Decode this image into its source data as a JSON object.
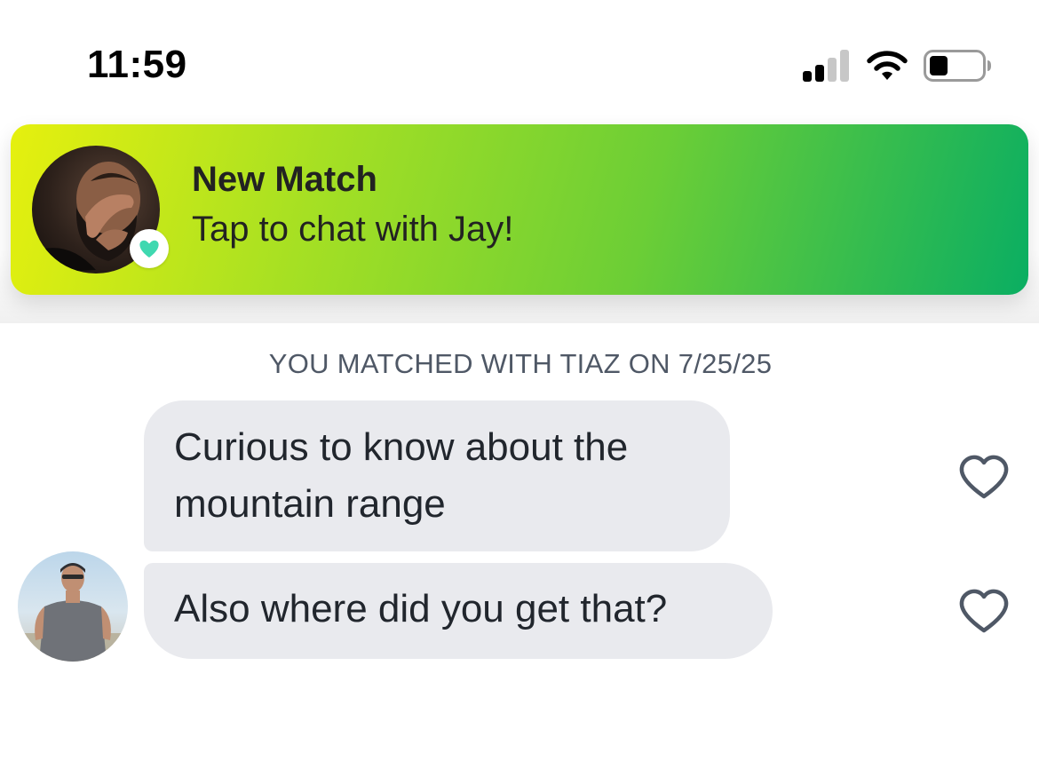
{
  "status_bar": {
    "time": "11:59",
    "icons": [
      "signal-icon",
      "wifi-icon",
      "battery-icon"
    ]
  },
  "notification": {
    "title": "New Match",
    "subtitle": "Tap to chat with Jay!",
    "badge_icon": "heart-icon",
    "gradient_colors": [
      "#e6f00e",
      "#6cce36",
      "#0aae62"
    ],
    "badge_heart_color": "#3fd8b0"
  },
  "conversation": {
    "match_caption": "YOU MATCHED WITH TIAZ ON 7/25/25",
    "messages": [
      {
        "text": "Curious to know about the mountain range",
        "like_icon": "heart-outline-icon"
      },
      {
        "text": "Also where did you get that?",
        "like_icon": "heart-outline-icon"
      }
    ],
    "bubble_color": "#e9eaee",
    "like_icon_color": "#4f5866"
  }
}
